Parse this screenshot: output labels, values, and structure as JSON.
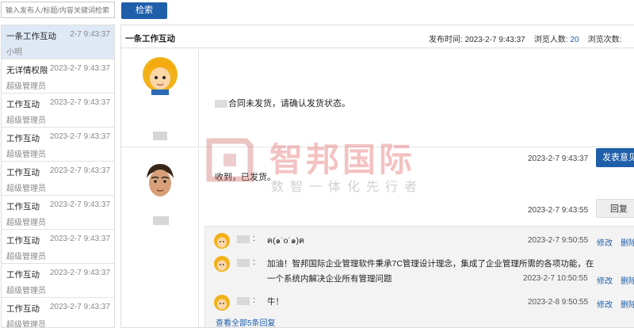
{
  "search": {
    "placeholder": "输入发布人/标题/内容关键词检索",
    "button_label": "检索"
  },
  "sidebar": {
    "items": [
      {
        "title": "一条工作互动",
        "date": "2-7 9:43:37",
        "user": "小明",
        "active": true
      },
      {
        "title": "无详情权限",
        "date": "2023-2-7 9:43:37",
        "user": "超级管理员"
      },
      {
        "title": "工作互动",
        "date": "2023-2-7 9:43:37",
        "user": "超级管理员"
      },
      {
        "title": "工作互动",
        "date": "2023-2-7 9:43:37",
        "user": "超级管理员"
      },
      {
        "title": "工作互动",
        "date": "2023-2-7 9:43:37",
        "user": "超级管理员"
      },
      {
        "title": "工作互动",
        "date": "2023-2-7 9:43:37",
        "user": "超级管理员"
      },
      {
        "title": "工作互动",
        "date": "2023-2-7 9:43:37",
        "user": "超级管理员"
      },
      {
        "title": "工作互动",
        "date": "2023-2-7 9:43:37",
        "user": "超级管理员"
      },
      {
        "title": "工作互动",
        "date": "2023-2-7 9:43:37",
        "user": "超级管理员"
      }
    ]
  },
  "main": {
    "title": "一条工作互动",
    "publish_label": "发布时间:",
    "publish_time": "2023-2-7 9:43:37",
    "views_label": "浏览人数:",
    "views_count": "20",
    "visits_label": "浏览次数:",
    "post1": {
      "text": "合同未发货，请确认发货状态。",
      "date": "2023-2-7 9:43:37",
      "button": "发表意见"
    },
    "post2": {
      "text": "收到，已发货。",
      "date": "2023-2-7 9:43:55",
      "button": "回复"
    },
    "replies": [
      {
        "text": "ฅ(๑˙o˙๑)ฅ",
        "date": "2023-2-7 9:50:55",
        "edit": "修改",
        "delete": "删除"
      },
      {
        "text": "加油！智邦国际企业管理软件秉承7C管理设计理念，集成了企业管理所需的各项功能，在",
        "text2": "一个系统内解决企业所有管理问题",
        "date": "2023-2-7 10:50:55",
        "edit": "修改",
        "delete": "删除"
      },
      {
        "text": "牛！",
        "date": "2023-2-8 9:50:55",
        "edit": "修改",
        "delete": "删除"
      }
    ],
    "view_all": "查看全部5条回复"
  },
  "watermark": {
    "brand": "智邦国际",
    "slogan": "数智一体化先行者"
  },
  "colors": {
    "accent": "#1f5faa",
    "active_item": "#dfe9f6"
  }
}
